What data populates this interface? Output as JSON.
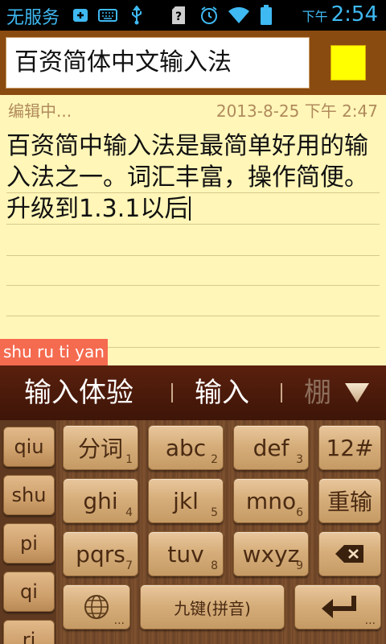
{
  "status_bar": {
    "carrier": "无服务",
    "icons": [
      "add-box-icon",
      "keyboard-icon",
      "usb-icon",
      "sim-unknown-icon",
      "alarm-icon",
      "wifi-icon",
      "battery-icon"
    ],
    "sim_glyph": "?",
    "ampm": "下午",
    "time": "2:54",
    "color": "#3fb9f2"
  },
  "title_bar": {
    "title_value": "百资简体中文输入法",
    "swatch_color": "#ffff00"
  },
  "note": {
    "status": "编辑中...",
    "date": "2013-8-25 下午 2:47",
    "text": "百资简中输入法是最简单好用的输入法之一。词汇丰富，操作简便。升级到1.3.1以后"
  },
  "composition": {
    "pinyin": "shu ru ti yan"
  },
  "candidates": {
    "items": [
      "输入体验",
      "输入",
      "棚"
    ],
    "expand_icon": "triangle-down-icon"
  },
  "keyboard": {
    "pinyin_options": [
      "qiu",
      "shu",
      "pi",
      "qi",
      "ri"
    ],
    "rows": [
      [
        {
          "label": "分词",
          "sub": "1"
        },
        {
          "label": "abc",
          "sub": "2"
        },
        {
          "label": "def",
          "sub": "3"
        },
        {
          "label": "12#",
          "sub": ""
        }
      ],
      [
        {
          "label": "ghi",
          "sub": "4"
        },
        {
          "label": "jkl",
          "sub": "5"
        },
        {
          "label": "mno",
          "sub": "6"
        },
        {
          "label": "重输",
          "sub": ""
        }
      ],
      [
        {
          "label": "pqrs",
          "sub": "7"
        },
        {
          "label": "tuv",
          "sub": "8"
        },
        {
          "label": "wxyz",
          "sub": "9"
        },
        {
          "label": "",
          "icon": "backspace-icon"
        }
      ]
    ],
    "bottom_row": {
      "globe_icon": "globe-icon",
      "globe_more": "...",
      "space_label": "九键(拼音)",
      "enter_icon": "enter-icon",
      "enter_more": "..."
    }
  }
}
